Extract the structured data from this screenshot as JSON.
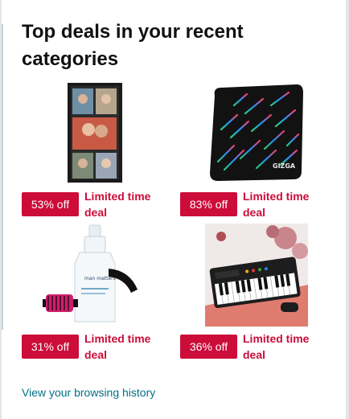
{
  "card": {
    "title": "Top deals in your recent categories"
  },
  "tiles": [
    {
      "name": "photo-frame",
      "discount": "53% off",
      "deal_label": "Limited time deal"
    },
    {
      "name": "mouse-pad",
      "discount": "83% off",
      "deal_label": "Limited time deal"
    },
    {
      "name": "derma-roller",
      "discount": "31% off",
      "deal_label": "Limited time deal",
      "product_text": "man matters"
    },
    {
      "name": "keyboard",
      "discount": "36% off",
      "deal_label": "Limited time deal"
    }
  ],
  "footer": {
    "history_link": "View your browsing history"
  },
  "colors": {
    "badge": "#cc0c39",
    "deal_text": "#cc0c39",
    "link": "#007185"
  }
}
